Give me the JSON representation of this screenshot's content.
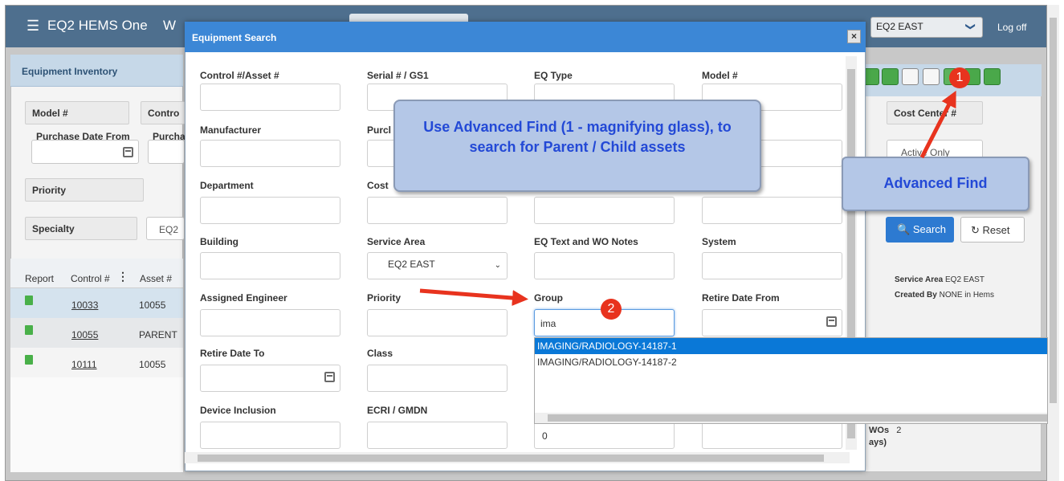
{
  "app": {
    "menu_icon": "hamburger-icon",
    "title": "EQ2 HEMS One",
    "title_cut": "W",
    "service_area": "EQ2 EAST",
    "logoff": "Log off"
  },
  "left": {
    "title": "Equipment Inventory",
    "model": "Model #",
    "control": "Contro",
    "purchase_from": "Purchase Date From",
    "purchase_to": "Purcha",
    "priority": "Priority",
    "specialty": "Specialty",
    "specialty_value": "EQ2",
    "table": {
      "headers": [
        "Report",
        "Control #",
        "Asset #"
      ],
      "rows": [
        {
          "control": "10033",
          "asset": "10055"
        },
        {
          "control": "10055",
          "asset": "PARENT"
        },
        {
          "control": "10111",
          "asset": "10055"
        }
      ]
    }
  },
  "right": {
    "cost_center": "Cost Center #",
    "active_only": "Active Only",
    "search": "Search",
    "reset": "Reset",
    "service_area_label": "Service Area",
    "service_area_value": "EQ2 EAST",
    "created_by_label": "Created By",
    "created_by_value": "NONE in Hems",
    "wos_label": "WOs",
    "wos_value": "2",
    "days": "ays)"
  },
  "modal": {
    "title": "Equipment Search",
    "close": "×",
    "fields": {
      "control": "Control #/Asset #",
      "serial": "Serial # / GS1",
      "eq_type": "EQ Type",
      "model": "Model #",
      "manufacturer": "Manufacturer",
      "purchase": "Purcl",
      "department": "Department",
      "cost": "Cost",
      "building": "Building",
      "service_area": "Service Area",
      "eq_text": "EQ Text and WO Notes",
      "system": "System",
      "assigned_engineer": "Assigned Engineer",
      "priority": "Priority",
      "group": "Group",
      "retire_from": "Retire Date From",
      "retire_to": "Retire Date To",
      "class": "Class",
      "device_inclusion": "Device Inclusion",
      "ecri": "ECRI / GMDN"
    },
    "service_area_value": "EQ2 EAST",
    "group_value": "ima",
    "zero_value": "0",
    "dropdown": [
      "IMAGING/RADIOLOGY-14187-1",
      "IMAGING/RADIOLOGY-14187-2"
    ]
  },
  "annotations": {
    "main_callout": "Use Advanced Find (1 - magnifying glass), to search for Parent / Child assets",
    "advanced_callout": "Advanced Find",
    "badge1": "1",
    "badge2": "2"
  },
  "colors": {
    "topbar": "#4e6f8e",
    "modal_header": "#3c87d6",
    "callout": "#b4c7e7",
    "callout_text": "#2349d6",
    "arrow": "#e8331e",
    "selected": "#0a78d7"
  }
}
